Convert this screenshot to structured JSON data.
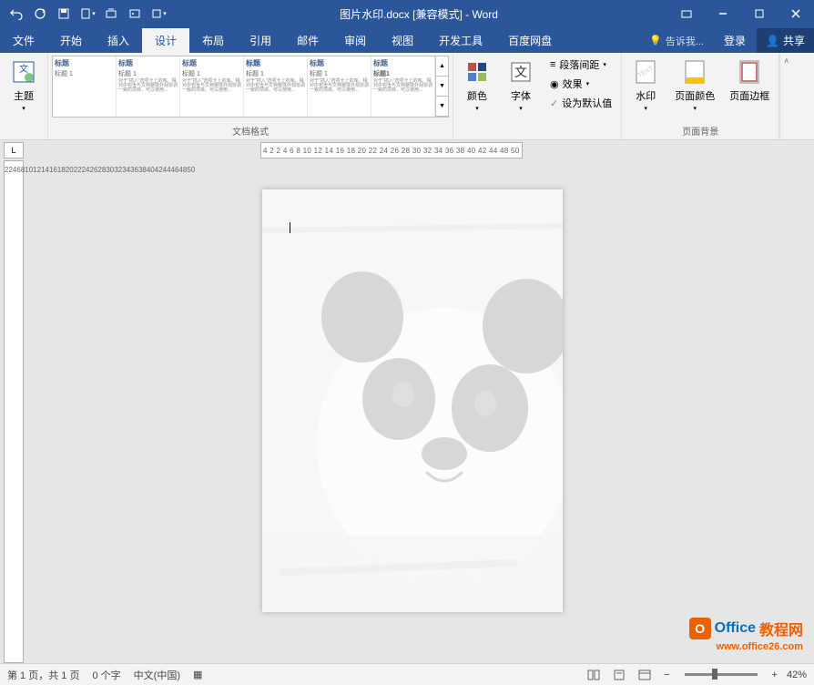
{
  "qat": {
    "undo": "↶",
    "redo": "↻",
    "save": "💾",
    "new": "▦",
    "open": "📋",
    "print": "🖶",
    "mode": "▭"
  },
  "title": "图片水印.docx [兼容模式] - Word",
  "tabs": {
    "file": "文件",
    "home": "开始",
    "insert": "插入",
    "design": "设计",
    "layout": "布局",
    "references": "引用",
    "mailings": "邮件",
    "review": "审阅",
    "view": "视图",
    "developer": "开发工具",
    "baidu": "百度网盘"
  },
  "tellme": "告诉我...",
  "login": "登录",
  "share": "共享",
  "ribbon": {
    "themes_label": "主题",
    "doc_format_label": "文档格式",
    "page_bg_label": "页面背景",
    "theme_item": {
      "title": "标题",
      "subtitle": "标题 1",
      "alt_subtitle": "标题1"
    },
    "colors": "颜色",
    "fonts": "字体",
    "paragraph_spacing": "段落间距",
    "effects": "效果",
    "set_default": "设为默认值",
    "watermark": "水印",
    "page_color": "页面颜色",
    "page_borders": "页面边框"
  },
  "ruler_h": "4  2       2   4   6   8  10 12 14 16 18 20 22 24 26 28 30 32 34 36 38 40 42 44     48 50",
  "ruler_v": [
    "2",
    "",
    "2",
    "4",
    "6",
    "8",
    "10",
    "12",
    "14",
    "16",
    "18",
    "20",
    "22",
    "24",
    "26",
    "28",
    "30",
    "32",
    "34",
    "36",
    "38",
    "40",
    "42",
    "44",
    "46",
    "48",
    "50"
  ],
  "status": {
    "page": "第 1 页，共 1 页",
    "words": "0 个字",
    "lang": "中文(中国)",
    "zoom": "42%"
  },
  "logo": {
    "text1": "Office",
    "text2": "教程网",
    "url": "www.office26.com"
  }
}
